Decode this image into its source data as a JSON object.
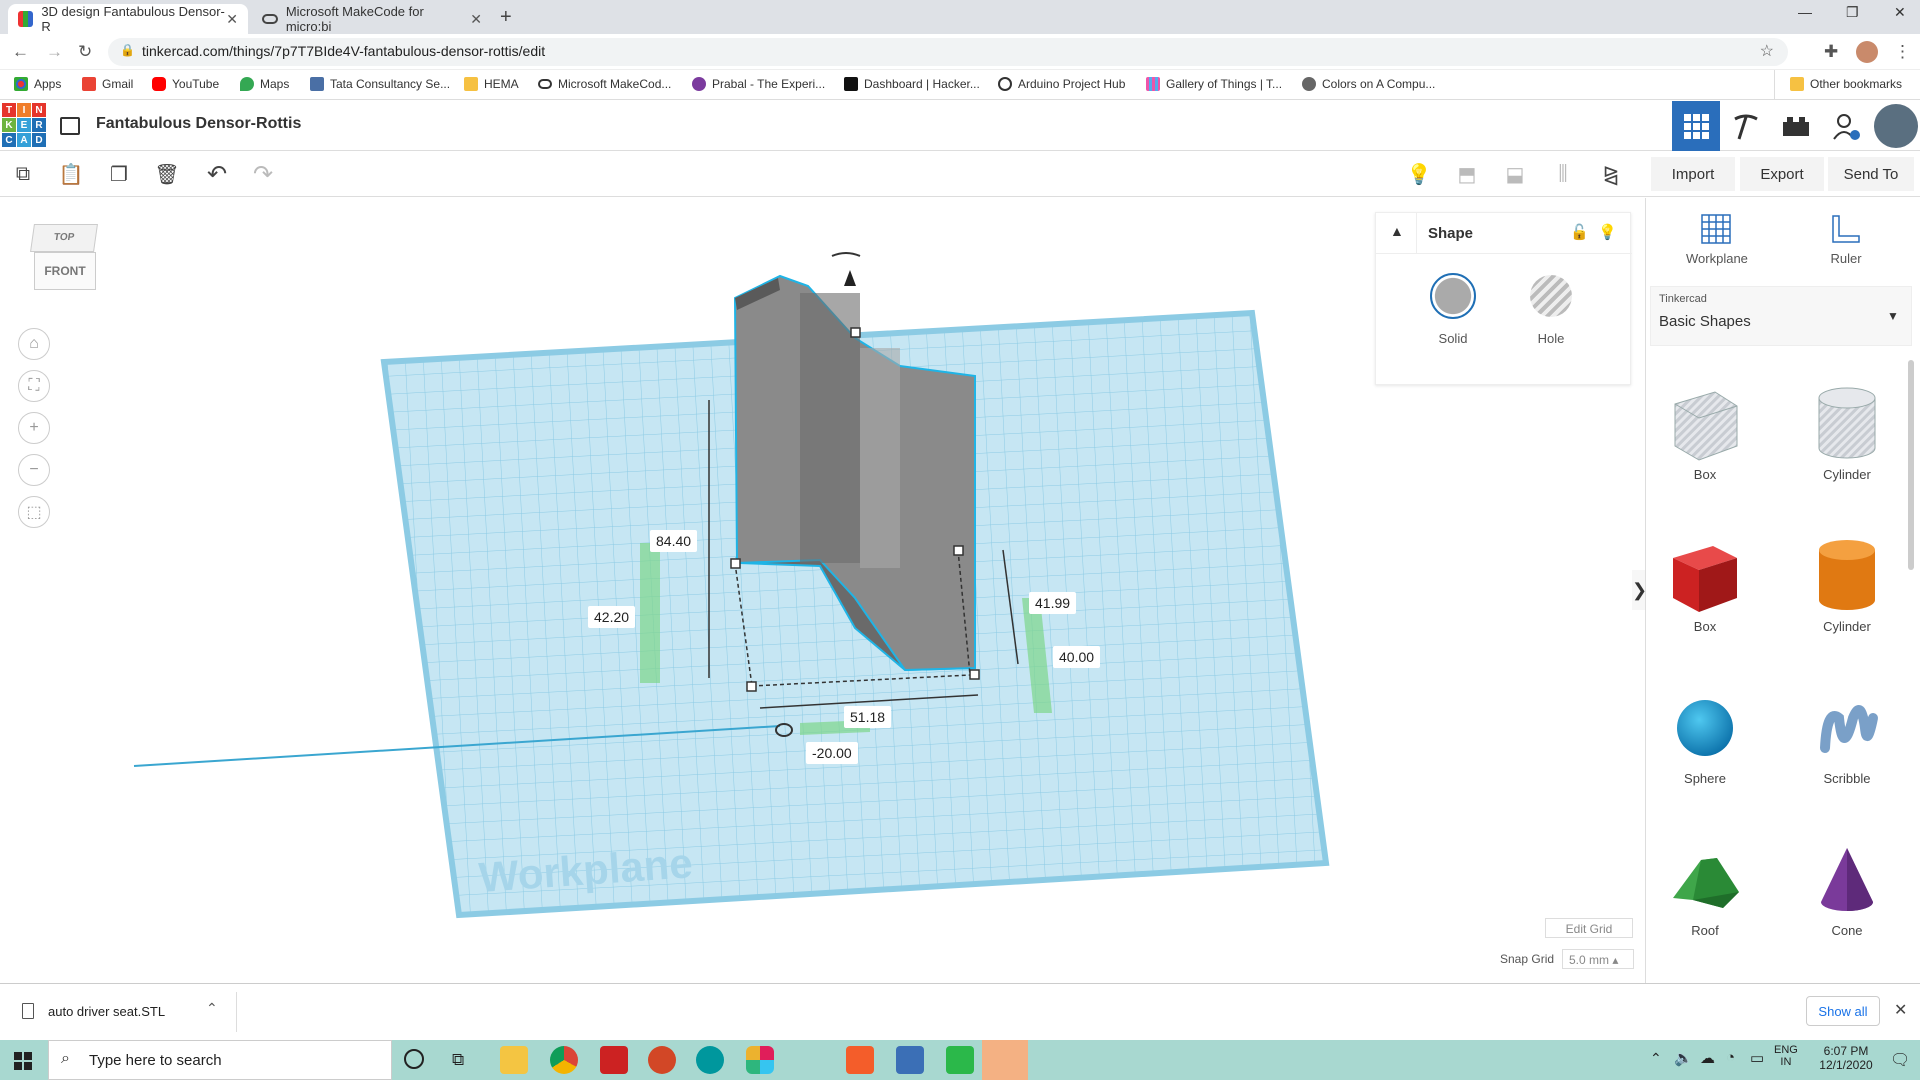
{
  "browser": {
    "tabs": [
      {
        "title": "3D design Fantabulous Densor-R",
        "active": true
      },
      {
        "title": "Microsoft MakeCode for micro:bi",
        "active": false
      }
    ],
    "url": "tinkercad.com/things/7p7T7BIde4V-fantabulous-densor-rottis/edit",
    "bookmarks": [
      "Apps",
      "Gmail",
      "YouTube",
      "Maps",
      "Tata Consultancy Se...",
      "HEMA",
      "Microsoft MakeCod...",
      "Prabal - The Experi...",
      "Dashboard | Hacker...",
      "Arduino Project Hub",
      "Gallery of Things | T...",
      "Colors on A Compu..."
    ],
    "other_bookmarks": "Other bookmarks"
  },
  "app": {
    "logo_letters": [
      "T",
      "I",
      "N",
      "K",
      "E",
      "R",
      "C",
      "A",
      "D"
    ],
    "title": "Fantabulous Densor-Rottis"
  },
  "toolbar": {
    "import_label": "Import",
    "export_label": "Export",
    "send_to_label": "Send To"
  },
  "viewcube": {
    "top": "TOP",
    "front": "FRONT"
  },
  "shape_panel": {
    "title": "Shape",
    "solid_label": "Solid",
    "hole_label": "Hole"
  },
  "dimensions": {
    "height": "84.40",
    "half_height": "42.20",
    "right_upper": "41.99",
    "right_lower": "40.00",
    "width": "51.18",
    "offset": "-20.00"
  },
  "workplane_label": "Workplane",
  "grid": {
    "edit_label": "Edit Grid",
    "snap_label": "Snap Grid",
    "snap_value": "5.0 mm"
  },
  "right_panel": {
    "workplane_label": "Workplane",
    "ruler_label": "Ruler",
    "library_source": "Tinkercad",
    "library_name": "Basic Shapes",
    "shapes": [
      {
        "label": "Box",
        "kind": "box-hole"
      },
      {
        "label": "Cylinder",
        "kind": "cyl-hole"
      },
      {
        "label": "Box",
        "kind": "box"
      },
      {
        "label": "Cylinder",
        "kind": "cylinder"
      },
      {
        "label": "Sphere",
        "kind": "sphere"
      },
      {
        "label": "Scribble",
        "kind": "scribble"
      },
      {
        "label": "Roof",
        "kind": "roof"
      },
      {
        "label": "Cone",
        "kind": "cone"
      }
    ]
  },
  "download_bar": {
    "file": "auto driver seat.STL",
    "show_all": "Show all"
  },
  "taskbar": {
    "search_placeholder": "Type here to search",
    "lang": "ENG",
    "region": "IN",
    "time": "6:07 PM",
    "date": "12/1/2020"
  },
  "colors": {
    "accent": "#2a6ebb",
    "workplane": "#bfe3f2",
    "selection": "#1fb4e6"
  }
}
